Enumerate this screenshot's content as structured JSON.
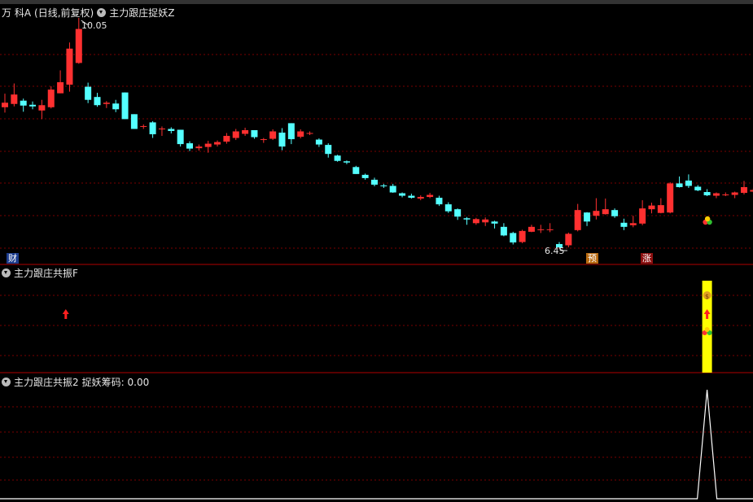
{
  "main_panel": {
    "stock_name": "万 科A",
    "period": "(日线,前复权)",
    "indicator": "主力跟庄捉妖Z",
    "high_label": "10.05",
    "low_label": "6.45",
    "tag_cai": "财",
    "tag_yu": "预",
    "tag_zhang": "涨"
  },
  "panel2": {
    "indicator": "主力跟庄共振F"
  },
  "panel3": {
    "indicator": "主力跟庄共振2",
    "metric_label": "捉妖筹码: 0.00"
  },
  "colors": {
    "up": "#ff3030",
    "down": "#54ffff",
    "divider": "#b00000",
    "grid": "#7a0000",
    "signal": "#ffff00",
    "line": "#ffffff"
  },
  "chart_data": {
    "type": "candlestick",
    "series": [
      {
        "o": 7.87,
        "c": 7.98,
        "h": 8.2,
        "l": 7.74
      },
      {
        "o": 7.95,
        "c": 8.18,
        "h": 8.45,
        "l": 7.89
      },
      {
        "o": 8.03,
        "c": 7.91,
        "h": 8.08,
        "l": 7.76
      },
      {
        "o": 7.93,
        "c": 7.89,
        "h": 8.01,
        "l": 7.82
      },
      {
        "o": 7.79,
        "c": 7.92,
        "h": 8.05,
        "l": 7.58
      },
      {
        "o": 7.87,
        "c": 8.3,
        "h": 8.38,
        "l": 7.84
      },
      {
        "o": 8.21,
        "c": 8.48,
        "h": 8.77,
        "l": 8.21
      },
      {
        "o": 8.42,
        "c": 9.3,
        "h": 9.45,
        "l": 8.25
      },
      {
        "o": 8.95,
        "c": 9.78,
        "h": 10.05,
        "l": 8.93
      },
      {
        "o": 8.37,
        "c": 8.05,
        "h": 8.47,
        "l": 7.97
      },
      {
        "o": 8.12,
        "c": 7.92,
        "h": 8.22,
        "l": 7.88
      },
      {
        "o": 7.95,
        "c": 7.98,
        "h": 8.02,
        "l": 7.85
      },
      {
        "o": 7.96,
        "c": 7.82,
        "h": 8.05,
        "l": 7.75
      },
      {
        "o": 8.23,
        "c": 7.58,
        "h": 8.23,
        "l": 7.58
      },
      {
        "o": 7.7,
        "c": 7.34,
        "h": 7.7,
        "l": 7.34
      },
      {
        "o": 7.39,
        "c": 7.41,
        "h": 7.45,
        "l": 7.34
      },
      {
        "o": 7.5,
        "c": 7.21,
        "h": 7.53,
        "l": 7.12
      },
      {
        "o": 7.33,
        "c": 7.35,
        "h": 7.4,
        "l": 7.17
      },
      {
        "o": 7.34,
        "c": 7.29,
        "h": 7.38,
        "l": 7.23
      },
      {
        "o": 7.32,
        "c": 6.97,
        "h": 7.32,
        "l": 6.91
      },
      {
        "o": 6.99,
        "c": 6.86,
        "h": 7.04,
        "l": 6.8
      },
      {
        "o": 6.87,
        "c": 6.91,
        "h": 6.96,
        "l": 6.81
      },
      {
        "o": 6.9,
        "c": 6.98,
        "h": 7.05,
        "l": 6.76
      },
      {
        "o": 6.96,
        "c": 7.02,
        "h": 7.06,
        "l": 6.91
      },
      {
        "o": 7.03,
        "c": 7.17,
        "h": 7.24,
        "l": 6.98
      },
      {
        "o": 7.12,
        "c": 7.28,
        "h": 7.34,
        "l": 7.07
      },
      {
        "o": 7.22,
        "c": 7.31,
        "h": 7.37,
        "l": 7.17
      },
      {
        "o": 7.31,
        "c": 7.14,
        "h": 7.31,
        "l": 7.1
      },
      {
        "o": 7.08,
        "c": 7.09,
        "h": 7.12,
        "l": 7.0
      },
      {
        "o": 7.1,
        "c": 7.28,
        "h": 7.33,
        "l": 7.07
      },
      {
        "o": 7.25,
        "c": 6.91,
        "h": 7.36,
        "l": 6.82
      },
      {
        "o": 7.48,
        "c": 7.09,
        "h": 7.48,
        "l": 6.97
      },
      {
        "o": 7.15,
        "c": 7.28,
        "h": 7.33,
        "l": 7.11
      },
      {
        "o": 7.24,
        "c": 7.24,
        "h": 7.28,
        "l": 7.19
      },
      {
        "o": 7.08,
        "c": 6.96,
        "h": 7.11,
        "l": 6.9
      },
      {
        "o": 6.95,
        "c": 6.73,
        "h": 6.99,
        "l": 6.64
      },
      {
        "o": 6.69,
        "c": 6.56,
        "h": 6.71,
        "l": 6.54
      },
      {
        "o": 6.55,
        "c": 6.52,
        "h": 6.57,
        "l": 6.48
      },
      {
        "o": 6.41,
        "c": 6.24,
        "h": 6.44,
        "l": 6.24
      },
      {
        "o": 6.22,
        "c": 6.14,
        "h": 6.25,
        "l": 6.1
      },
      {
        "o": 6.1,
        "c": 5.98,
        "h": 6.15,
        "l": 5.94
      },
      {
        "o": 5.96,
        "c": 5.94,
        "h": 6.0,
        "l": 5.9
      },
      {
        "o": 5.95,
        "c": 5.79,
        "h": 6.0,
        "l": 5.78
      },
      {
        "o": 5.77,
        "c": 5.71,
        "h": 5.79,
        "l": 5.67
      },
      {
        "o": 5.71,
        "c": 5.66,
        "h": 5.76,
        "l": 5.64
      },
      {
        "o": 5.64,
        "c": 5.68,
        "h": 5.72,
        "l": 5.6
      },
      {
        "o": 5.68,
        "c": 5.73,
        "h": 5.78,
        "l": 5.65
      },
      {
        "o": 5.66,
        "c": 5.5,
        "h": 5.71,
        "l": 5.46
      },
      {
        "o": 5.5,
        "c": 5.33,
        "h": 5.55,
        "l": 5.29
      },
      {
        "o": 5.38,
        "c": 5.2,
        "h": 5.4,
        "l": 5.12
      },
      {
        "o": 5.16,
        "c": 5.13,
        "h": 5.19,
        "l": 5.0
      },
      {
        "o": 5.04,
        "c": 5.14,
        "h": 5.17,
        "l": 5.0
      },
      {
        "o": 5.06,
        "c": 5.13,
        "h": 5.18,
        "l": 4.97
      },
      {
        "o": 5.08,
        "c": 5.03,
        "h": 5.1,
        "l": 4.91
      },
      {
        "o": 4.95,
        "c": 4.74,
        "h": 5.04,
        "l": 4.72
      },
      {
        "o": 4.8,
        "c": 4.57,
        "h": 4.83,
        "l": 4.52
      },
      {
        "o": 4.58,
        "c": 4.85,
        "h": 4.88,
        "l": 4.55
      },
      {
        "o": 4.83,
        "c": 4.95,
        "h": 5.0,
        "l": 4.82
      },
      {
        "o": 4.89,
        "c": 4.89,
        "h": 5.0,
        "l": 4.8
      },
      {
        "o": 4.88,
        "c": 4.89,
        "h": 5.04,
        "l": 4.82
      },
      {
        "o": 4.53,
        "c": 4.45,
        "h": 4.58,
        "l": 4.45
      },
      {
        "o": 4.5,
        "c": 4.78,
        "h": 4.81,
        "l": 4.45
      },
      {
        "o": 4.87,
        "c": 5.36,
        "h": 5.51,
        "l": 4.84
      },
      {
        "o": 5.3,
        "c": 5.08,
        "h": 5.31,
        "l": 4.97
      },
      {
        "o": 5.22,
        "c": 5.34,
        "h": 5.65,
        "l": 5.13
      },
      {
        "o": 5.26,
        "c": 5.38,
        "h": 5.64,
        "l": 5.25
      },
      {
        "o": 5.36,
        "c": 5.21,
        "h": 5.4,
        "l": 5.17
      },
      {
        "o": 5.05,
        "c": 4.95,
        "h": 5.15,
        "l": 4.87
      },
      {
        "o": 4.99,
        "c": 5.04,
        "h": 5.22,
        "l": 4.94
      },
      {
        "o": 5.03,
        "c": 5.4,
        "h": 5.6,
        "l": 4.99
      },
      {
        "o": 5.38,
        "c": 5.47,
        "h": 5.54,
        "l": 5.28
      },
      {
        "o": 5.29,
        "c": 5.48,
        "h": 5.65,
        "l": 5.28
      },
      {
        "o": 5.3,
        "c": 6.01,
        "h": 6.04,
        "l": 5.28
      },
      {
        "o": 6.01,
        "c": 5.92,
        "h": 6.18,
        "l": 5.91
      },
      {
        "o": 6.08,
        "c": 5.95,
        "h": 6.23,
        "l": 5.9
      },
      {
        "o": 5.93,
        "c": 5.84,
        "h": 5.97,
        "l": 5.82
      },
      {
        "o": 5.8,
        "c": 5.72,
        "h": 5.87,
        "l": 5.7
      },
      {
        "o": 5.71,
        "c": 5.77,
        "h": 5.79,
        "l": 5.65
      },
      {
        "o": 5.73,
        "c": 5.74,
        "h": 5.79,
        "l": 5.7
      },
      {
        "o": 5.73,
        "c": 5.79,
        "h": 5.81,
        "l": 5.65
      },
      {
        "o": 5.78,
        "c": 5.92,
        "h": 6.07,
        "l": 5.74
      },
      {
        "o": 5.81,
        "c": 5.85,
        "h": 5.89,
        "l": 5.79
      },
      {
        "o": 5.83,
        "c": 5.94,
        "h": 6.0,
        "l": 5.82
      },
      {
        "o": 5.83,
        "c": 5.93,
        "h": 5.96,
        "l": 5.79
      }
    ],
    "signals": {
      "prebreak_index": 76,
      "arrow_index": 8,
      "resonance_index": 76,
      "spike_index": 76,
      "spike_value": 1
    }
  }
}
